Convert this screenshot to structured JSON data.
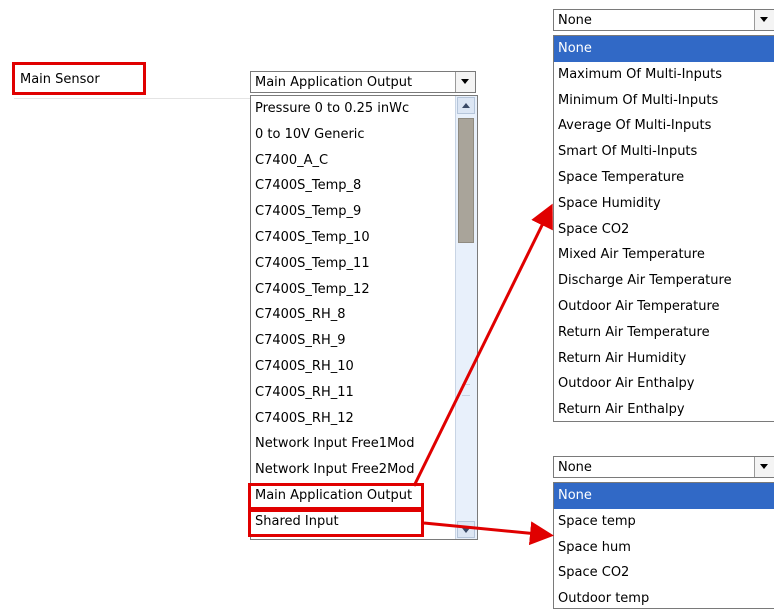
{
  "main_sensor": {
    "label": "Main Sensor",
    "selected": "Main Application Output",
    "options": [
      "Pressure 0 to 0.25 inWc",
      "0 to 10V Generic",
      "C7400_A_C",
      "C7400S_Temp_8",
      "C7400S_Temp_9",
      "C7400S_Temp_10",
      "C7400S_Temp_11",
      "C7400S_Temp_12",
      "C7400S_RH_8",
      "C7400S_RH_9",
      "C7400S_RH_10",
      "C7400S_RH_11",
      "C7400S_RH_12",
      "Network Input Free1Mod",
      "Network Input Free2Mod",
      "Main Application Output",
      "Shared Input"
    ]
  },
  "app_output_dropdown": {
    "selected": "None",
    "options": [
      "None",
      "Maximum Of Multi-Inputs",
      "Minimum Of Multi-Inputs",
      "Average Of Multi-Inputs",
      "Smart Of Multi-Inputs",
      "Space Temperature",
      "Space Humidity",
      "Space CO2",
      "Mixed Air Temperature",
      "Discharge Air Temperature",
      "Outdoor Air Temperature",
      "Return Air Temperature",
      "Return Air Humidity",
      "Outdoor Air Enthalpy",
      "Return Air Enthalpy"
    ]
  },
  "shared_input_dropdown": {
    "selected": "None",
    "options": [
      "None",
      "Space temp",
      "Space hum",
      "Space CO2",
      "Outdoor temp"
    ]
  },
  "colors": {
    "highlight": "#e00000",
    "selection": "#3169c6"
  }
}
